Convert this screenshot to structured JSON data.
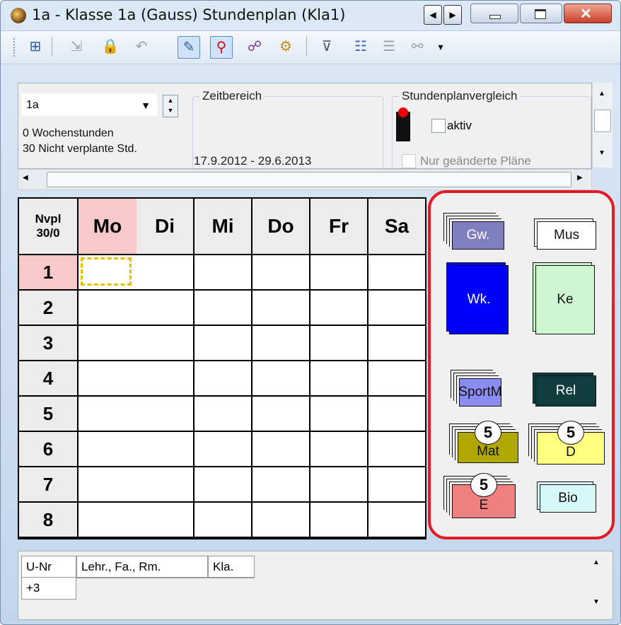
{
  "window": {
    "title": "1a - Klasse 1a (Gauss)  Stundenplan  (Kla1)",
    "nav_prev": "◀",
    "nav_next": "▶",
    "minimize": "minimize",
    "maximize": "maximize",
    "close": "close"
  },
  "toolbar": {
    "icons": [
      "grid-icon",
      "export-icon",
      "lock-icon",
      "undo-icon",
      "palette-icon",
      "pin-icon",
      "people-icon",
      "gear-icon",
      "filter-icon",
      "list-icon",
      "split-icon",
      "compare-icon",
      "dropdown-icon"
    ]
  },
  "info": {
    "class_value": "1a",
    "weekly_hours": "0  Wochenstunden",
    "unplanned": "30  Nicht verplante Std.",
    "zeitbereich_label": "Zeitbereich",
    "date_range": "17.9.2012 - 29.6.2013",
    "vergleich_label": "Stundenplanvergleich",
    "aktiv_label": "aktiv",
    "nur_label": "Nur geänderte Pläne"
  },
  "timetable": {
    "corner_top": "Nvpl",
    "corner_bottom": "30/0",
    "days": [
      "Mo",
      "Di",
      "Mi",
      "Do",
      "Fr",
      "Sa"
    ],
    "periods": [
      "1",
      "2",
      "3",
      "4",
      "5",
      "6",
      "7",
      "8"
    ],
    "colors": {
      "highlight": "#f9c8c8",
      "selected_border": "#e8c000"
    }
  },
  "lessons": [
    {
      "label": "Gw.",
      "color": "#8080c0",
      "text_color": "#ffffff"
    },
    {
      "label": "Mus",
      "color": "#ffffff",
      "text_color": "#111111"
    },
    {
      "label": "Wk.",
      "color": "#0000ff",
      "text_color": "#ffffff"
    },
    {
      "label": "Ke",
      "color": "#ccf5d0",
      "text_color": "#111111"
    },
    {
      "label": "SportM",
      "color": "#8a8cf0",
      "text_color": "#111111"
    },
    {
      "label": "Rel",
      "color": "#0f3c3c",
      "text_color": "#ffffff"
    },
    {
      "label": "Mat",
      "color": "#b0a800",
      "text_color": "#111111",
      "badge": "5"
    },
    {
      "label": "D",
      "color": "#ffff80",
      "text_color": "#111111",
      "badge": "5"
    },
    {
      "label": "E",
      "color": "#f08080",
      "text_color": "#111111",
      "badge": "5"
    },
    {
      "label": "Bio",
      "color": "#d8f8f8",
      "text_color": "#111111"
    }
  ],
  "bottom_table": {
    "headers": [
      "U-Nr",
      "Lehr., Fa., Rm.",
      "Kla."
    ],
    "rows": [
      [
        "+3",
        "",
        ""
      ]
    ]
  }
}
